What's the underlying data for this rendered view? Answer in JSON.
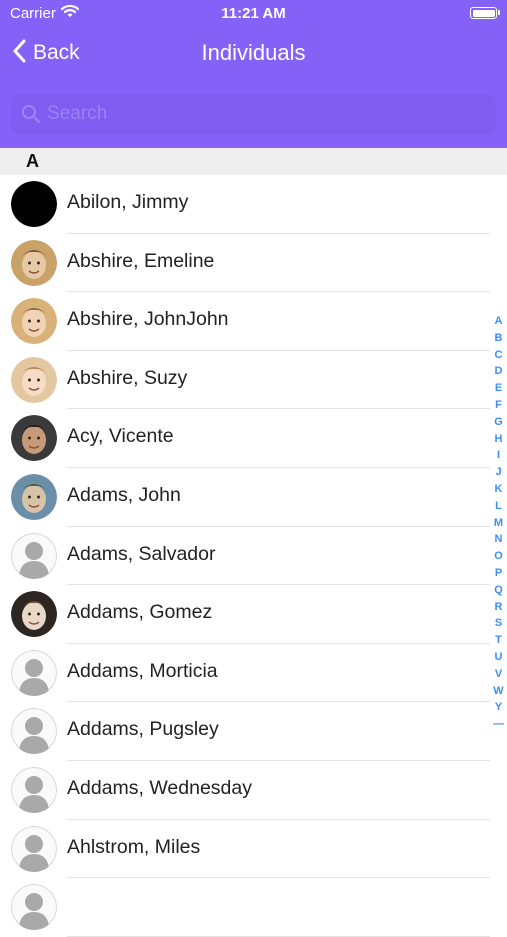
{
  "status_bar": {
    "carrier": "Carrier",
    "time": "11:21 AM"
  },
  "nav": {
    "back_label": "Back",
    "title": "Individuals"
  },
  "search": {
    "placeholder": "Search",
    "value": ""
  },
  "section": {
    "letter": "A"
  },
  "contacts": [
    {
      "name": "Abilon, Jimmy",
      "avatar": "black"
    },
    {
      "name": "Abshire, Emeline",
      "avatar": "photo"
    },
    {
      "name": "Abshire, JohnJohn",
      "avatar": "photo"
    },
    {
      "name": "Abshire, Suzy",
      "avatar": "photo"
    },
    {
      "name": "Acy, Vicente",
      "avatar": "photo"
    },
    {
      "name": "Adams, John",
      "avatar": "photo"
    },
    {
      "name": "Adams, Salvador",
      "avatar": "placeholder"
    },
    {
      "name": "Addams, Gomez",
      "avatar": "photo"
    },
    {
      "name": "Addams, Morticia",
      "avatar": "placeholder"
    },
    {
      "name": "Addams, Pugsley",
      "avatar": "placeholder"
    },
    {
      "name": "Addams, Wednesday",
      "avatar": "placeholder"
    },
    {
      "name": "Ahlstrom, Miles",
      "avatar": "placeholder"
    },
    {
      "name": "",
      "avatar": "placeholder"
    }
  ],
  "index_letters": [
    "A",
    "B",
    "C",
    "D",
    "E",
    "F",
    "G",
    "H",
    "I",
    "J",
    "K",
    "L",
    "M",
    "N",
    "O",
    "P",
    "Q",
    "R",
    "S",
    "T",
    "U",
    "V",
    "W",
    "Y",
    "—"
  ],
  "colors": {
    "header": "#8562f7",
    "search_field": "#7f5df0",
    "index_accent": "#3f8ef7",
    "section_header": "#efefef"
  },
  "icons": {
    "back": "chevron-left-icon",
    "search": "magnifier-icon",
    "wifi": "wifi-icon",
    "battery": "battery-icon",
    "avatar_placeholder": "person-silhouette-icon"
  }
}
